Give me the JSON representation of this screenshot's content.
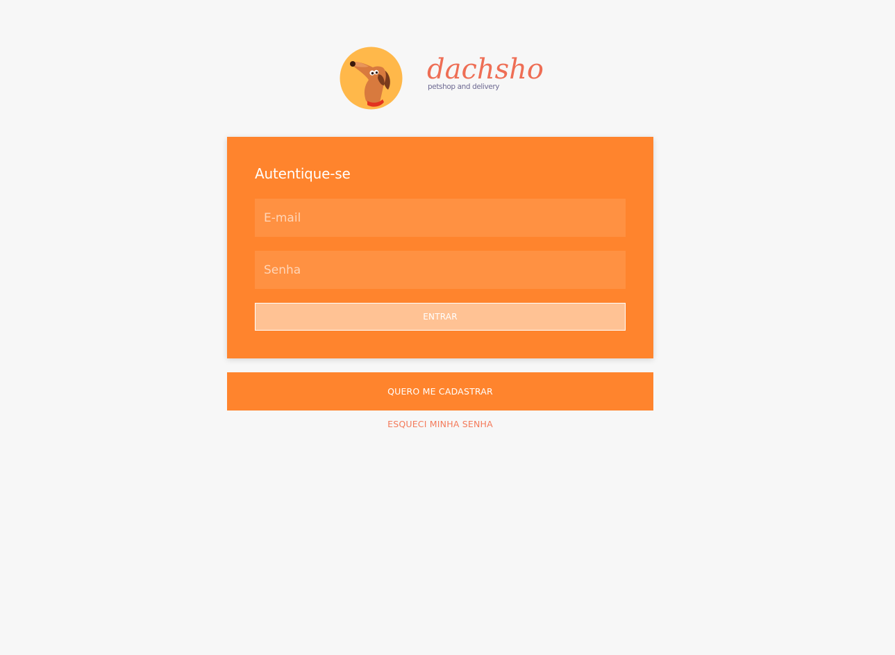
{
  "brand": {
    "name": "dachshop",
    "tagline": "petshop and delivery",
    "logo_icon": "dachshund-dog-icon",
    "colors": {
      "primary_orange": "#ff842d",
      "logo_circle": "#ffb84a",
      "wordmark": "#ee6e55",
      "tagline": "#6e6a92"
    }
  },
  "login": {
    "title": "Autentique-se",
    "email_placeholder": "E-mail",
    "email_value": "",
    "password_placeholder": "Senha",
    "password_value": "",
    "submit_label": "ENTRAR"
  },
  "register": {
    "label": "QUERO ME CADASTRAR"
  },
  "forgot": {
    "label": "ESQUECI MINHA SENHA"
  }
}
